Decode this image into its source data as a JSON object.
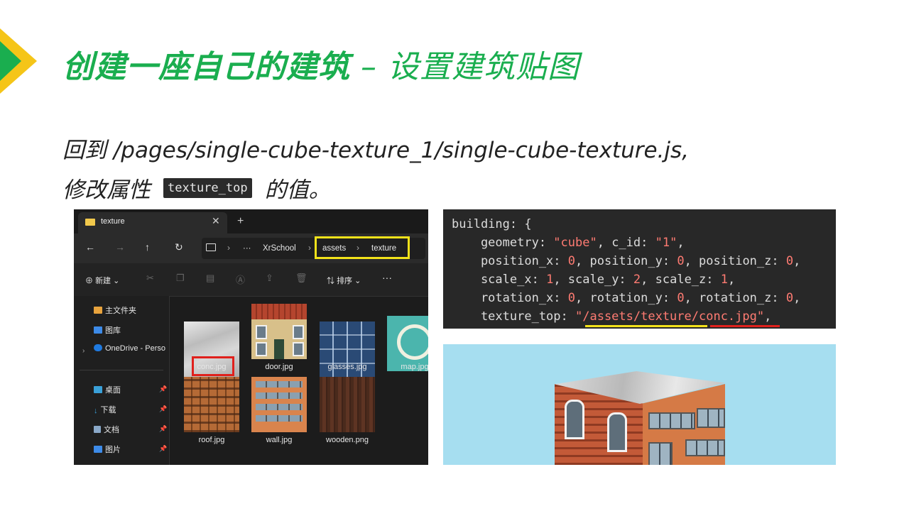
{
  "slide": {
    "title_main": "创建一座自己的建筑",
    "title_sub": " – 设置建筑贴图",
    "desc_line1": "回到 /pages/single-cube-texture_1/single-cube-texture.js,",
    "desc_line2_prefix": "修改属性",
    "desc_code": "texture_top",
    "desc_line2_suffix": "的值。"
  },
  "explorer": {
    "tab_title": "texture",
    "tab_close": "✕",
    "new_tab": "+",
    "nav": {
      "back": "←",
      "forward": "→",
      "up": "↑",
      "refresh": "↻"
    },
    "breadcrumbs": [
      "XrSchool",
      "assets",
      "texture"
    ],
    "more": "···",
    "toolbar": {
      "new_label": "新建",
      "sort_label": "排序",
      "more": "···"
    },
    "sidebar": [
      {
        "label": "主文件夹",
        "icon": "home-icon"
      },
      {
        "label": "图库",
        "icon": "gallery-icon"
      },
      {
        "label": "OneDrive - Perso",
        "icon": "cloud-icon"
      },
      {
        "label": "桌面",
        "icon": "desktop-icon"
      },
      {
        "label": "下载",
        "icon": "download-icon"
      },
      {
        "label": "文档",
        "icon": "document-icon"
      },
      {
        "label": "图片",
        "icon": "picture-icon"
      }
    ],
    "files": [
      {
        "name": "conc.jpg"
      },
      {
        "name": "door.jpg"
      },
      {
        "name": "glasses.jpg"
      },
      {
        "name": "map.jpg"
      },
      {
        "name": "roof.jpg"
      },
      {
        "name": "wall.jpg"
      },
      {
        "name": "wooden.png"
      }
    ]
  },
  "code": {
    "l1a": "building: {",
    "l2a": "    geometry: ",
    "l2b": "\"cube\"",
    "l2c": ", c_id: ",
    "l2d": "\"1\"",
    "l2e": ",",
    "l3a": "    position_x: ",
    "l3b": "0",
    "l3c": ", position_y: ",
    "l3d": "0",
    "l3e": ", position_z: ",
    "l3f": "0",
    "l3g": ",",
    "l4a": "    scale_x: ",
    "l4b": "1",
    "l4c": ", scale_y: ",
    "l4d": "2",
    "l4e": ", scale_z: ",
    "l4f": "1",
    "l4g": ",",
    "l5a": "    rotation_x: ",
    "l5b": "0",
    "l5c": ", rotation_y: ",
    "l5d": "0",
    "l5e": ", rotation_z: ",
    "l5f": "0",
    "l5g": ",",
    "l6a": "    texture_top: ",
    "l6b": "\"/assets/texture/conc.jpg\"",
    "l6c": ","
  },
  "colors": {
    "accent_green": "#1aae4f",
    "accent_yellow": "#f5c518",
    "highlight_red": "#e0201c"
  }
}
